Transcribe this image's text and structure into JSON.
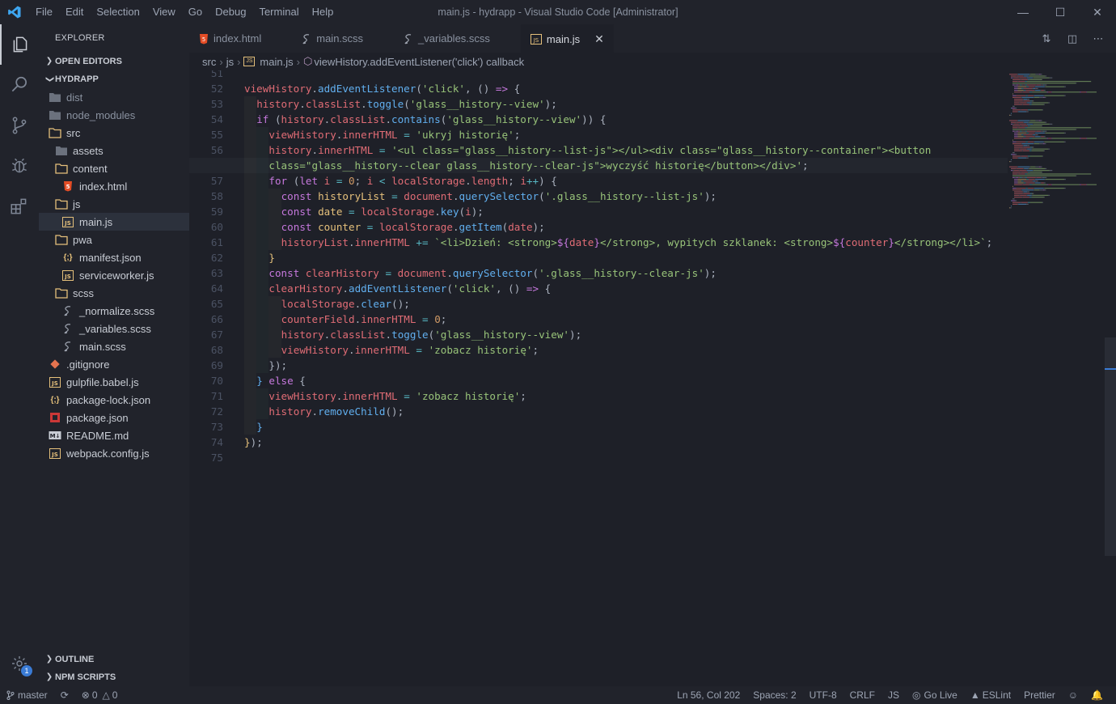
{
  "titlebar": {
    "menu": [
      "File",
      "Edit",
      "Selection",
      "View",
      "Go",
      "Debug",
      "Terminal",
      "Help"
    ],
    "title": "main.js - hydrapp - Visual Studio Code [Administrator]",
    "controls": [
      "minimize",
      "maximize",
      "close"
    ]
  },
  "activity_bar": {
    "items": [
      "explorer-icon",
      "search-icon",
      "source-control-icon",
      "debug-icon",
      "extensions-icon"
    ],
    "settings_badge": "1"
  },
  "sidebar": {
    "title": "EXPLORER",
    "open_editors_label": "OPEN EDITORS",
    "project_label": "HYDRAPP",
    "tree": [
      {
        "label": "dist",
        "type": "folder",
        "depth": 0,
        "dim": true
      },
      {
        "label": "node_modules",
        "type": "folder",
        "depth": 0,
        "dim": true
      },
      {
        "label": "src",
        "type": "folder-open",
        "depth": 0
      },
      {
        "label": "assets",
        "type": "folder",
        "depth": 1
      },
      {
        "label": "content",
        "type": "folder-open",
        "depth": 1
      },
      {
        "label": "index.html",
        "type": "html",
        "depth": 2
      },
      {
        "label": "js",
        "type": "folder-open",
        "depth": 1
      },
      {
        "label": "main.js",
        "type": "js",
        "depth": 2,
        "selected": true
      },
      {
        "label": "pwa",
        "type": "folder-open",
        "depth": 1
      },
      {
        "label": "manifest.json",
        "type": "json",
        "depth": 2
      },
      {
        "label": "serviceworker.js",
        "type": "js",
        "depth": 2
      },
      {
        "label": "scss",
        "type": "folder-open",
        "depth": 1
      },
      {
        "label": "_normalize.scss",
        "type": "scss",
        "depth": 2
      },
      {
        "label": "_variables.scss",
        "type": "scss",
        "depth": 2
      },
      {
        "label": "main.scss",
        "type": "scss",
        "depth": 2
      },
      {
        "label": ".gitignore",
        "type": "git",
        "depth": 0
      },
      {
        "label": "gulpfile.babel.js",
        "type": "js",
        "depth": 0
      },
      {
        "label": "package-lock.json",
        "type": "json",
        "depth": 0
      },
      {
        "label": "package.json",
        "type": "npm",
        "depth": 0
      },
      {
        "label": "README.md",
        "type": "md",
        "depth": 0
      },
      {
        "label": "webpack.config.js",
        "type": "js",
        "depth": 0
      }
    ],
    "outline_label": "OUTLINE",
    "npm_scripts_label": "NPM SCRIPTS"
  },
  "tabs": [
    {
      "label": "index.html",
      "type": "html",
      "active": false
    },
    {
      "label": "main.scss",
      "type": "scss",
      "active": false
    },
    {
      "label": "_variables.scss",
      "type": "scss",
      "active": false
    },
    {
      "label": "main.js",
      "type": "js",
      "active": true
    }
  ],
  "breadcrumb": {
    "parts": [
      "src",
      "js",
      "main.js"
    ],
    "symbol": "viewHistory.addEventListener('click') callback"
  },
  "editor": {
    "current_line": 56,
    "lines": [
      {
        "n": "51",
        "indent": 0,
        "tokens": []
      },
      {
        "n": "52",
        "indent": 0,
        "tokens": [
          [
            "v",
            "viewHistory"
          ],
          [
            "p",
            "."
          ],
          [
            "f",
            "addEventListener"
          ],
          [
            "p",
            "("
          ],
          [
            "s",
            "'click'"
          ],
          [
            "p",
            ", () "
          ],
          [
            "k",
            "=>"
          ],
          [
            "p",
            " {"
          ]
        ]
      },
      {
        "n": "53",
        "indent": 1,
        "tokens": [
          [
            "v",
            "history"
          ],
          [
            "p",
            "."
          ],
          [
            "v",
            "classList"
          ],
          [
            "p",
            "."
          ],
          [
            "f",
            "toggle"
          ],
          [
            "p",
            "("
          ],
          [
            "s",
            "'glass__history--view'"
          ],
          [
            "p",
            ");"
          ]
        ]
      },
      {
        "n": "54",
        "indent": 1,
        "tokens": [
          [
            "k",
            "if"
          ],
          [
            "p",
            " ("
          ],
          [
            "v",
            "history"
          ],
          [
            "p",
            "."
          ],
          [
            "v",
            "classList"
          ],
          [
            "p",
            "."
          ],
          [
            "f",
            "contains"
          ],
          [
            "p",
            "("
          ],
          [
            "s",
            "'glass__history--view'"
          ],
          [
            "p",
            ")) {"
          ]
        ]
      },
      {
        "n": "55",
        "indent": 2,
        "tokens": [
          [
            "v",
            "viewHistory"
          ],
          [
            "p",
            "."
          ],
          [
            "v",
            "innerHTML"
          ],
          [
            "o",
            " = "
          ],
          [
            "s",
            "'ukryj historię'"
          ],
          [
            "p",
            ";"
          ]
        ]
      },
      {
        "n": "56",
        "indent": 2,
        "tokens": [
          [
            "v",
            "history"
          ],
          [
            "p",
            "."
          ],
          [
            "v",
            "innerHTML"
          ],
          [
            "o",
            " = "
          ],
          [
            "s",
            "'<ul class=\"glass__history--list-js\"></ul><div class=\"glass__history--container\"><button"
          ]
        ]
      },
      {
        "n": "",
        "indent": 2,
        "cur": true,
        "tokens": [
          [
            "s",
            "class=\"glass__history--clear glass__history--clear-js\">wyczyść historię</button></div>'"
          ],
          [
            "p",
            ";"
          ]
        ]
      },
      {
        "n": "57",
        "indent": 2,
        "tokens": [
          [
            "k",
            "for"
          ],
          [
            "p",
            " ("
          ],
          [
            "k",
            "let"
          ],
          [
            "v",
            " i"
          ],
          [
            "o",
            " = "
          ],
          [
            "n",
            "0"
          ],
          [
            "p",
            "; "
          ],
          [
            "v",
            "i"
          ],
          [
            "o",
            " < "
          ],
          [
            "v",
            "localStorage"
          ],
          [
            "p",
            "."
          ],
          [
            "v",
            "length"
          ],
          [
            "p",
            "; "
          ],
          [
            "v",
            "i"
          ],
          [
            "o",
            "++"
          ],
          [
            "p",
            ") {"
          ]
        ]
      },
      {
        "n": "58",
        "indent": 3,
        "tokens": [
          [
            "k",
            "const"
          ],
          [
            "y",
            " historyList"
          ],
          [
            "o",
            " = "
          ],
          [
            "v",
            "document"
          ],
          [
            "p",
            "."
          ],
          [
            "f",
            "querySelector"
          ],
          [
            "p",
            "("
          ],
          [
            "s",
            "'.glass__history--list-js'"
          ],
          [
            "p",
            ");"
          ]
        ]
      },
      {
        "n": "59",
        "indent": 3,
        "tokens": [
          [
            "k",
            "const"
          ],
          [
            "y",
            " date"
          ],
          [
            "o",
            " = "
          ],
          [
            "v",
            "localStorage"
          ],
          [
            "p",
            "."
          ],
          [
            "f",
            "key"
          ],
          [
            "p",
            "("
          ],
          [
            "v",
            "i"
          ],
          [
            "p",
            ");"
          ]
        ]
      },
      {
        "n": "60",
        "indent": 3,
        "tokens": [
          [
            "k",
            "const"
          ],
          [
            "y",
            " counter"
          ],
          [
            "o",
            " = "
          ],
          [
            "v",
            "localStorage"
          ],
          [
            "p",
            "."
          ],
          [
            "f",
            "getItem"
          ],
          [
            "p",
            "("
          ],
          [
            "v",
            "date"
          ],
          [
            "p",
            ");"
          ]
        ]
      },
      {
        "n": "61",
        "indent": 3,
        "tokens": [
          [
            "v",
            "historyList"
          ],
          [
            "p",
            "."
          ],
          [
            "v",
            "innerHTML"
          ],
          [
            "o",
            " += "
          ],
          [
            "s",
            "`<li>Dzień: <strong>"
          ],
          [
            "k",
            "${"
          ],
          [
            "v",
            "date"
          ],
          [
            "k",
            "}"
          ],
          [
            "s",
            "</strong>, wypitych szklanek: <strong>"
          ],
          [
            "k",
            "${"
          ],
          [
            "v",
            "counter"
          ],
          [
            "k",
            "}"
          ],
          [
            "s",
            "</strong></li>`"
          ],
          [
            "p",
            ";"
          ]
        ]
      },
      {
        "n": "62",
        "indent": 2,
        "tokens": [
          [
            "y",
            "}"
          ]
        ]
      },
      {
        "n": "63",
        "indent": 2,
        "tokens": [
          [
            "k",
            "const"
          ],
          [
            "v",
            " clearHistory"
          ],
          [
            "o",
            " = "
          ],
          [
            "v",
            "document"
          ],
          [
            "p",
            "."
          ],
          [
            "f",
            "querySelector"
          ],
          [
            "p",
            "("
          ],
          [
            "s",
            "'.glass__history--clear-js'"
          ],
          [
            "p",
            ");"
          ]
        ]
      },
      {
        "n": "64",
        "indent": 2,
        "tokens": [
          [
            "v",
            "clearHistory"
          ],
          [
            "p",
            "."
          ],
          [
            "f",
            "addEventListener"
          ],
          [
            "p",
            "("
          ],
          [
            "s",
            "'click'"
          ],
          [
            "p",
            ", () "
          ],
          [
            "k",
            "=>"
          ],
          [
            "p",
            " {"
          ]
        ]
      },
      {
        "n": "65",
        "indent": 3,
        "tokens": [
          [
            "v",
            "localStorage"
          ],
          [
            "p",
            "."
          ],
          [
            "f",
            "clear"
          ],
          [
            "p",
            "();"
          ]
        ]
      },
      {
        "n": "66",
        "indent": 3,
        "tokens": [
          [
            "v",
            "counterField"
          ],
          [
            "p",
            "."
          ],
          [
            "v",
            "innerHTML"
          ],
          [
            "o",
            " = "
          ],
          [
            "n",
            "0"
          ],
          [
            "p",
            ";"
          ]
        ]
      },
      {
        "n": "67",
        "indent": 3,
        "tokens": [
          [
            "v",
            "history"
          ],
          [
            "p",
            "."
          ],
          [
            "v",
            "classList"
          ],
          [
            "p",
            "."
          ],
          [
            "f",
            "toggle"
          ],
          [
            "p",
            "("
          ],
          [
            "s",
            "'glass__history--view'"
          ],
          [
            "p",
            ");"
          ]
        ]
      },
      {
        "n": "68",
        "indent": 3,
        "tokens": [
          [
            "v",
            "viewHistory"
          ],
          [
            "p",
            "."
          ],
          [
            "v",
            "innerHTML"
          ],
          [
            "o",
            " = "
          ],
          [
            "s",
            "'zobacz historię'"
          ],
          [
            "p",
            ";"
          ]
        ]
      },
      {
        "n": "69",
        "indent": 2,
        "tokens": [
          [
            "p",
            "});"
          ]
        ]
      },
      {
        "n": "70",
        "indent": 1,
        "tokens": [
          [
            "f",
            "}"
          ],
          [
            "k",
            " else"
          ],
          [
            "p",
            " {"
          ]
        ]
      },
      {
        "n": "71",
        "indent": 2,
        "tokens": [
          [
            "v",
            "viewHistory"
          ],
          [
            "p",
            "."
          ],
          [
            "v",
            "innerHTML"
          ],
          [
            "o",
            " = "
          ],
          [
            "s",
            "'zobacz historię'"
          ],
          [
            "p",
            ";"
          ]
        ]
      },
      {
        "n": "72",
        "indent": 2,
        "tokens": [
          [
            "v",
            "history"
          ],
          [
            "p",
            "."
          ],
          [
            "f",
            "removeChild"
          ],
          [
            "p",
            "();"
          ]
        ]
      },
      {
        "n": "73",
        "indent": 1,
        "tokens": [
          [
            "f",
            "}"
          ]
        ]
      },
      {
        "n": "74",
        "indent": 0,
        "tokens": [
          [
            "y",
            "}"
          ],
          [
            "p",
            ");"
          ]
        ]
      },
      {
        "n": "75",
        "indent": 0,
        "tokens": []
      }
    ]
  },
  "statusbar": {
    "branch": "master",
    "errors": "0",
    "warnings": "0",
    "position": "Ln 56, Col 202",
    "spaces": "Spaces: 2",
    "encoding": "UTF-8",
    "eol": "CRLF",
    "language": "JS",
    "go_live": "Go Live",
    "eslint": "ESLint",
    "prettier": "Prettier"
  },
  "colors": {
    "keyword": "#c678dd",
    "variable": "#e06c75",
    "function": "#61afef",
    "string": "#98c379",
    "operator": "#56b6c2",
    "number": "#d19a66",
    "const_name": "#e5c07b",
    "editor_bg": "#1e2028",
    "sidebar_bg": "#21232b"
  }
}
